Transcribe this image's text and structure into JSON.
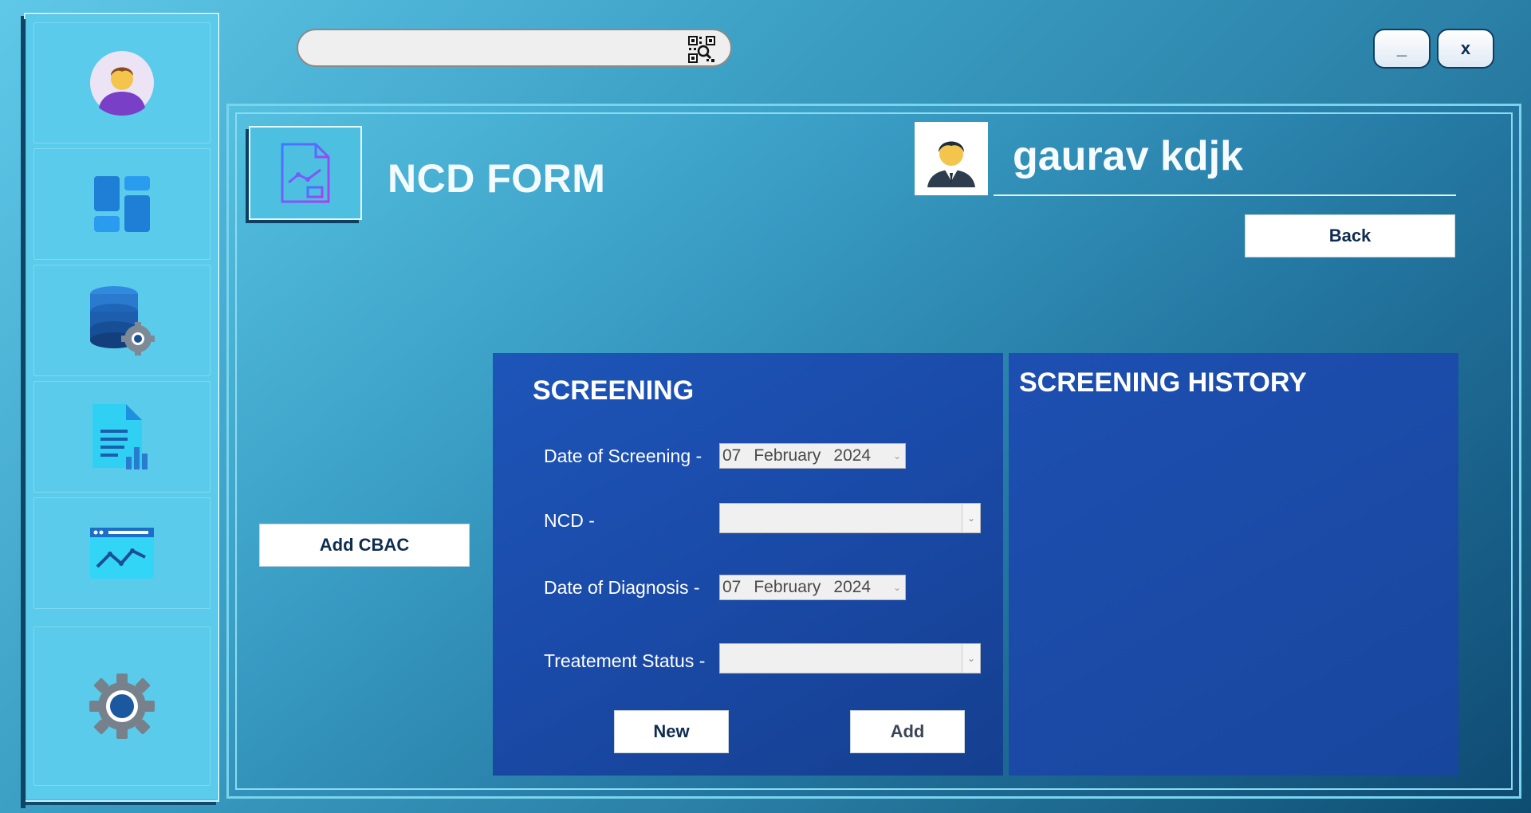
{
  "search": {
    "value": "",
    "icon": "qr-scan-icon"
  },
  "window": {
    "minimize_label": "_",
    "close_label": "x"
  },
  "sidebar": {
    "items": [
      {
        "name": "profile",
        "icon": "user-avatar-icon"
      },
      {
        "name": "dashboard",
        "icon": "dashboard-icon"
      },
      {
        "name": "database",
        "icon": "database-settings-icon"
      },
      {
        "name": "reports",
        "icon": "report-document-icon"
      },
      {
        "name": "analytics",
        "icon": "analytics-chart-icon"
      },
      {
        "name": "settings",
        "icon": "gear-icon"
      }
    ]
  },
  "header": {
    "title": "NCD FORM",
    "username": "gaurav kdjk",
    "back_label": "Back"
  },
  "actions": {
    "add_cbac_label": "Add CBAC"
  },
  "screening": {
    "title": "SCREENING",
    "date_of_screening_label": "Date of Screening -",
    "date_of_screening": {
      "day": "07",
      "month": "February",
      "year": "2024"
    },
    "ncd_label": "NCD -",
    "ncd_value": "",
    "date_of_diagnosis_label": "Date of Diagnosis -",
    "date_of_diagnosis": {
      "day": "07",
      "month": "February",
      "year": "2024"
    },
    "treatment_status_label": "Treatement Status -",
    "treatment_status_value": "",
    "new_label": "New",
    "add_label": "Add"
  },
  "history": {
    "title": "SCREENING HISTORY"
  },
  "colors": {
    "panel_blue": "#1b4ca9",
    "sidebar_cyan": "#5bcbeb",
    "text_dark": "#0e2c50"
  }
}
